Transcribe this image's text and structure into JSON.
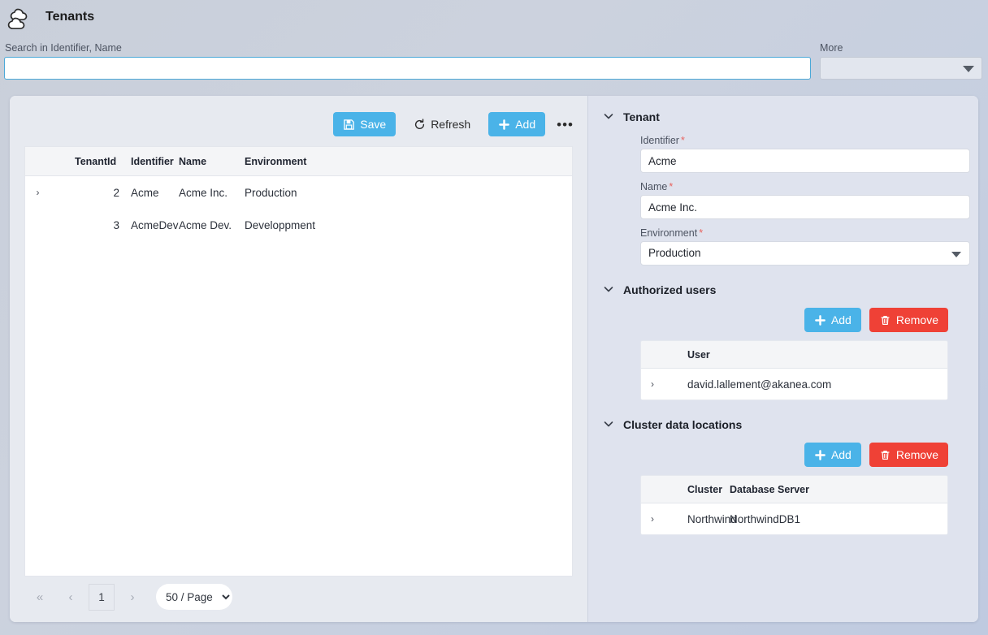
{
  "header": {
    "logo_icon": "clouds-icon",
    "title": "Tenants"
  },
  "search": {
    "label": "Search in Identifier, Name",
    "value": "",
    "placeholder": ""
  },
  "more": {
    "label": "More",
    "value": ""
  },
  "toolbar": {
    "save_label": "Save",
    "refresh_label": "Refresh",
    "add_label": "Add",
    "overflow_label": "•••"
  },
  "tenants_grid": {
    "columns": [
      "",
      "TenantId",
      "Identifier",
      "Name",
      "Environment"
    ],
    "rows": [
      {
        "expand": "›",
        "tenant_id": "2",
        "identifier": "Acme",
        "name": "Acme Inc.",
        "environment": "Production"
      },
      {
        "expand": "",
        "tenant_id": "3",
        "identifier": "AcmeDev",
        "name": "Acme Dev.",
        "environment": "Developpment"
      }
    ]
  },
  "pagination": {
    "first": "«",
    "prev": "‹",
    "current_page": "1",
    "next": "›",
    "page_size": "50 / Page"
  },
  "tenant_section": {
    "title": "Tenant",
    "fields": {
      "identifier_label": "Identifier",
      "identifier_value": "Acme",
      "name_label": "Name",
      "name_value": "Acme Inc.",
      "environment_label": "Environment",
      "environment_value": "Production"
    },
    "required_marker": "*"
  },
  "authorized_users_section": {
    "title": "Authorized users",
    "add_label": "Add",
    "remove_label": "Remove",
    "columns": [
      "",
      "User"
    ],
    "rows": [
      {
        "expand": "›",
        "user": "david.lallement@akanea.com"
      }
    ]
  },
  "cluster_locations_section": {
    "title": "Cluster data locations",
    "add_label": "Add",
    "remove_label": "Remove",
    "columns": [
      "",
      "Cluster",
      "Database Server"
    ],
    "rows": [
      {
        "expand": "›",
        "cluster": "Northwind",
        "database_server": "NorthwindDB1"
      }
    ]
  },
  "colors": {
    "accent_blue": "#4ab3e8",
    "danger_red": "#ef4136",
    "required_red": "#e8645f",
    "panel_bg": "#dfe3ee",
    "page_bg": "#c9cfda"
  }
}
